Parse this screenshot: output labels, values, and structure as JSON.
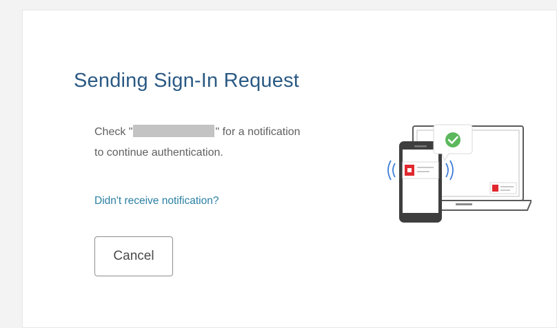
{
  "dialog": {
    "title": "Sending Sign-In Request",
    "message_prefix": "Check \"",
    "message_suffix": "\" for a notification",
    "message_line2": "to continue authentication.",
    "help_link": "Didn't receive notification?",
    "cancel_label": "Cancel"
  },
  "illustration": {
    "icon": "phone-laptop-notification-illustration",
    "phone_icon": "smartphone-icon",
    "laptop_icon": "laptop-icon",
    "check_icon": "green-checkmark-icon",
    "signal_icon": "wireless-signal-icon"
  },
  "colors": {
    "title": "#2b5a84",
    "link": "#2a7fa3",
    "check": "#5cb85c",
    "brand_red": "#e0282f"
  }
}
